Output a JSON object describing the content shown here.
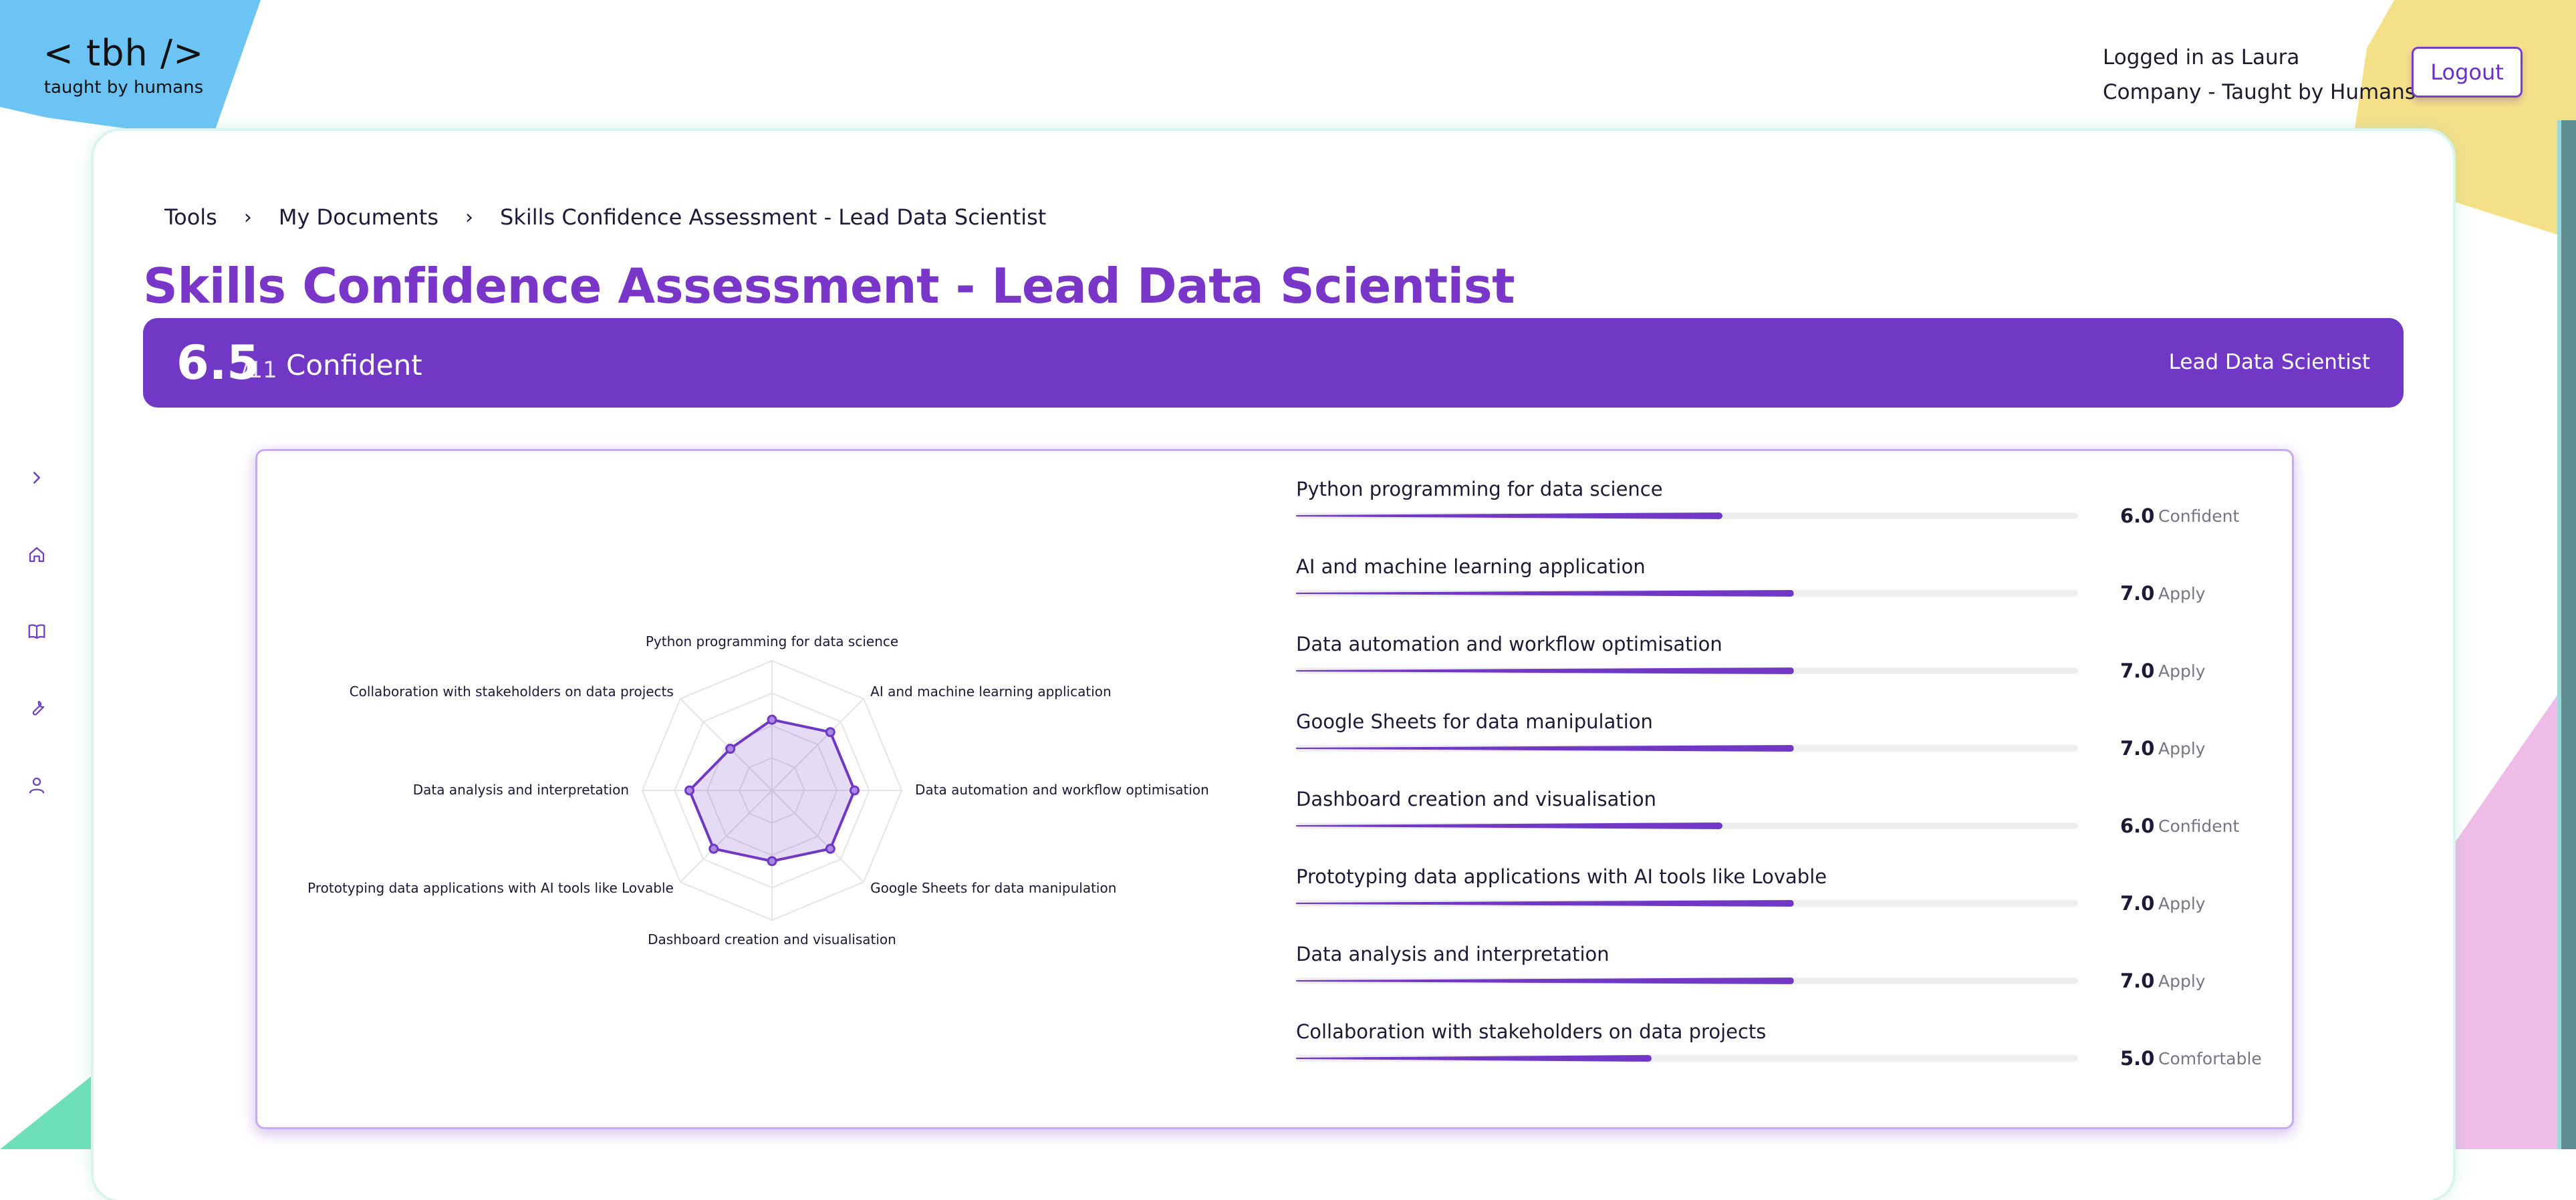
{
  "logo": {
    "mark": "< tbh />",
    "sub": "taught by humans"
  },
  "user": {
    "logged_in": "Logged in as Laura",
    "company": "Company - Taught by Humans"
  },
  "header": {
    "logout_label": "Logout"
  },
  "sidebar": {
    "items": [
      "chevron-right-icon",
      "home-icon",
      "book-icon",
      "wrench-icon",
      "user-icon"
    ]
  },
  "breadcrumb": {
    "items": [
      "Tools",
      "My Documents",
      "Skills Confidence Assessment - Lead Data Scientist"
    ]
  },
  "page": {
    "title": "Skills Confidence Assessment - Lead Data Scientist"
  },
  "summary": {
    "score": "6.5",
    "max": "/11",
    "level": "Confident",
    "role": "Lead Data Scientist"
  },
  "colors": {
    "accent": "#7138c6",
    "title": "#7a35c9",
    "track": "#eeeef1"
  },
  "chart_data": {
    "type": "radar",
    "max": 11,
    "categories": [
      "Python programming for data science",
      "AI and machine learning application",
      "Data automation and workflow optimisation",
      "Google Sheets for data manipulation",
      "Dashboard creation and visualisation",
      "Prototyping data applications with AI tools like Lovable",
      "Data analysis and interpretation",
      "Collaboration with stakeholders on data projects"
    ],
    "values": [
      6.0,
      7.0,
      7.0,
      7.0,
      6.0,
      7.0,
      7.0,
      5.0
    ]
  },
  "skills": [
    {
      "name": "Python programming for data science",
      "score": "6.0",
      "level": "Confident",
      "value": 6.0
    },
    {
      "name": "AI and machine learning application",
      "score": "7.0",
      "level": "Apply",
      "value": 7.0
    },
    {
      "name": "Data automation and workflow optimisation",
      "score": "7.0",
      "level": "Apply",
      "value": 7.0
    },
    {
      "name": "Google Sheets for data manipulation",
      "score": "7.0",
      "level": "Apply",
      "value": 7.0
    },
    {
      "name": "Dashboard creation and visualisation",
      "score": "6.0",
      "level": "Confident",
      "value": 6.0
    },
    {
      "name": "Prototyping data applications with AI tools like Lovable",
      "score": "7.0",
      "level": "Apply",
      "value": 7.0
    },
    {
      "name": "Data analysis and interpretation",
      "score": "7.0",
      "level": "Apply",
      "value": 7.0
    },
    {
      "name": "Collaboration with stakeholders on data projects",
      "score": "5.0",
      "level": "Comfortable",
      "value": 5.0
    }
  ]
}
